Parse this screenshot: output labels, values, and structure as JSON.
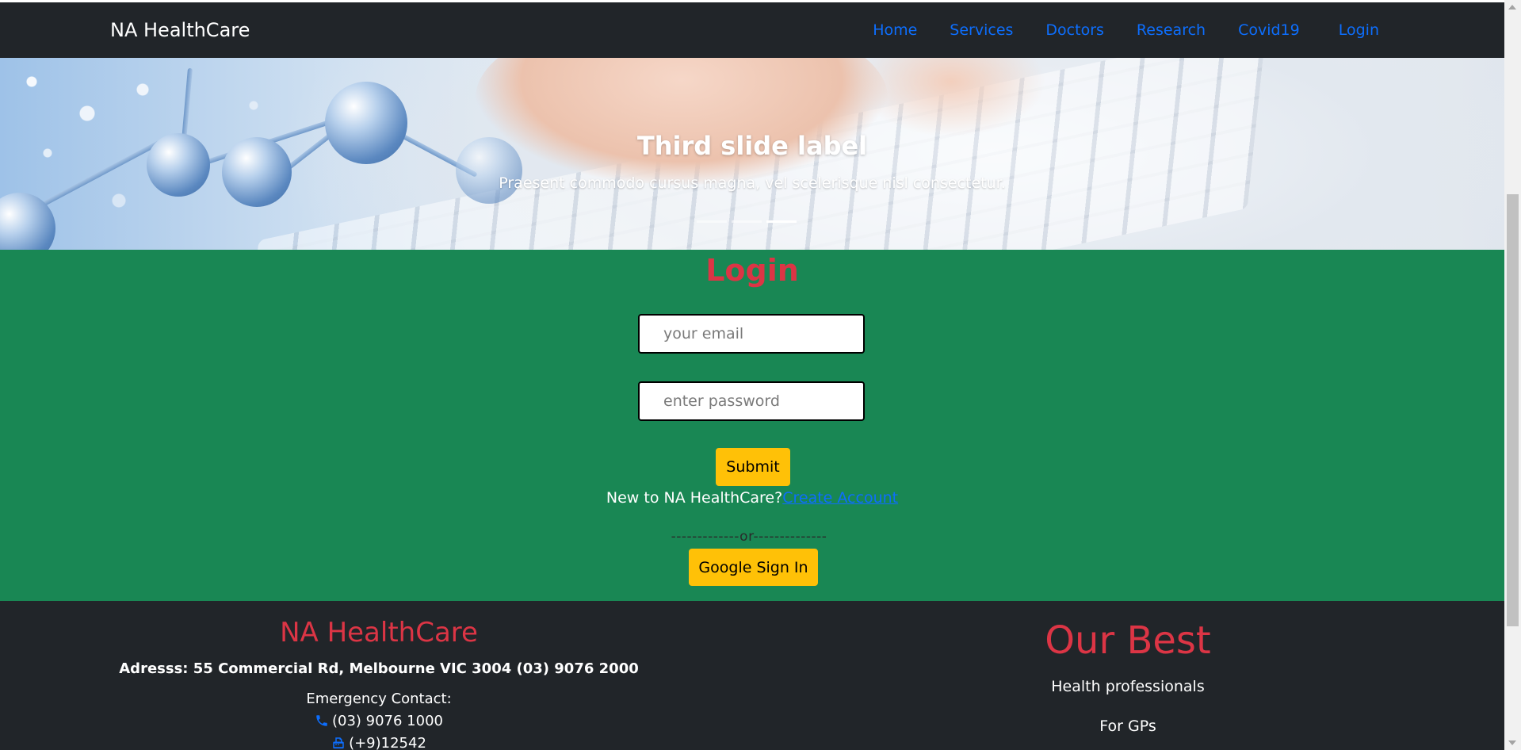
{
  "nav": {
    "brand": "NA HealthCare",
    "links": [
      "Home",
      "Services",
      "Doctors",
      "Research",
      "Covid19",
      "Login"
    ]
  },
  "hero": {
    "title": "Third slide label",
    "text": "Praesent commodo cursus magna, vel scelerisque nisl consectetur.",
    "slide_count": 3,
    "active_slide": 3
  },
  "login": {
    "title": "Login",
    "email_placeholder": "your email",
    "password_placeholder": "enter password",
    "submit_label": "Submit",
    "new_text": "New to NA HealthCare?",
    "create_account": "Create Account",
    "or_text": "-------------or--------------",
    "google_label": "Google Sign In"
  },
  "footer": {
    "brand": "NA HealthCare",
    "address": "Adresss: 55 Commercial Rd, Melbourne VIC 3004 (03) 9076 2000",
    "emergency_label": "Emergency Contact:",
    "phone": "(03) 9076 1000",
    "fax": "(+9)12542",
    "best_title": "Our Best",
    "best_items": [
      "Health professionals",
      "For GPs"
    ]
  },
  "colors": {
    "navbar": "#212529",
    "link": "#0d6efd",
    "login_bg": "#198754",
    "title_red": "#dc3545",
    "button": "#ffc107"
  },
  "icons": [
    "phone-icon",
    "fax-icon"
  ]
}
